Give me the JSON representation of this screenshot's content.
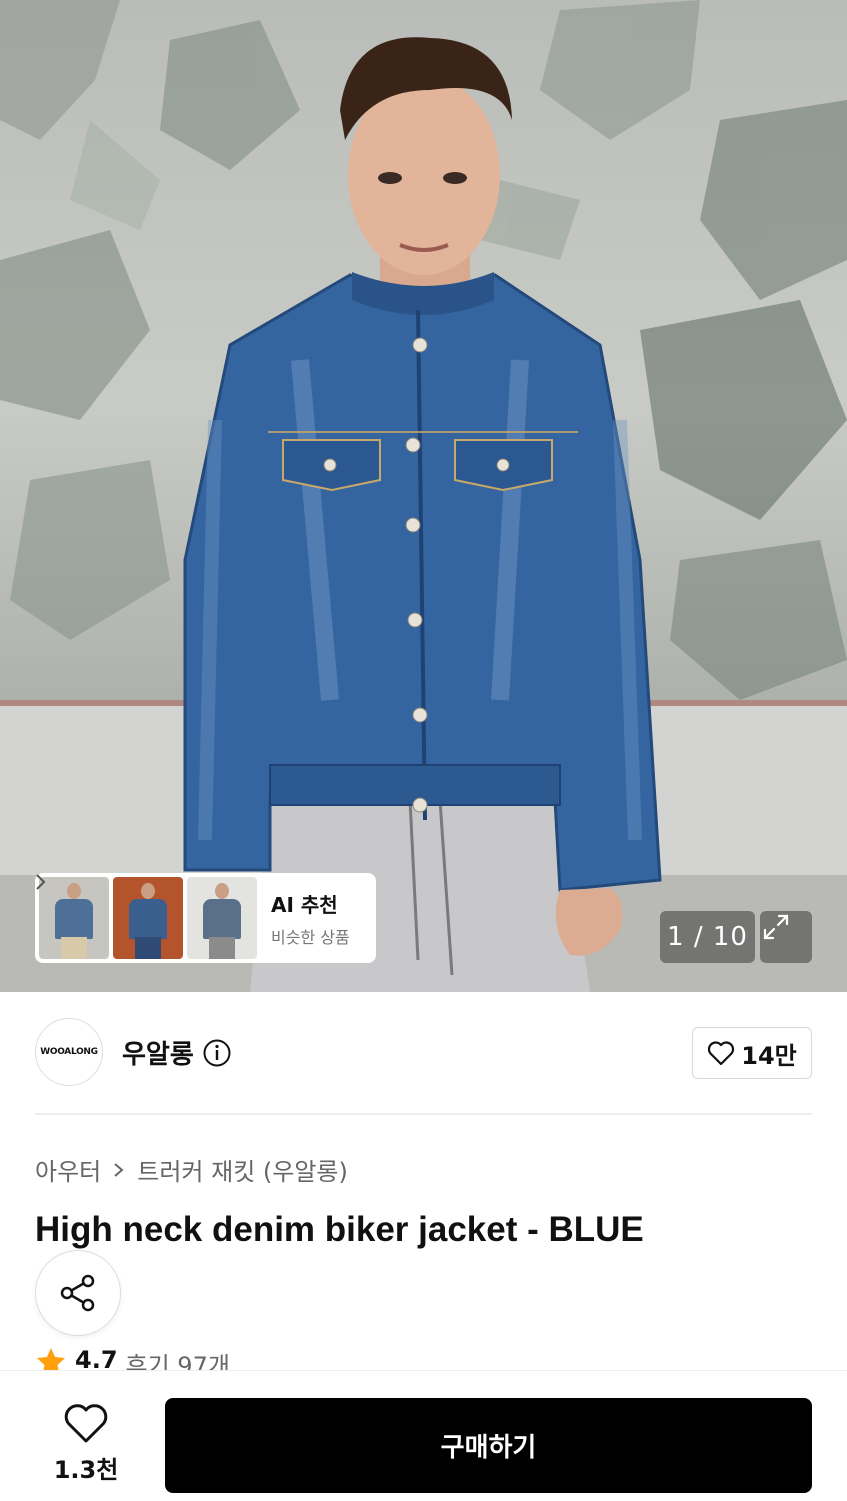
{
  "hero": {
    "image_alt": "Model wearing high neck denim biker jacket",
    "counter": "1 / 10"
  },
  "ai_recommend": {
    "title": "AI 추천",
    "subtitle": "비슷한 상품"
  },
  "brand": {
    "logo_text": "WOOALONG",
    "name": "우알롱",
    "likes": "14만"
  },
  "product": {
    "breadcrumb": [
      "아우터",
      "트러커 재킷 (우알롱)"
    ],
    "title": "High neck denim biker jacket - BLUE",
    "rating": "4.7",
    "reviews": "후기 97개"
  },
  "bottom_bar": {
    "like_count": "1.3천",
    "buy_label": "구매하기"
  },
  "colors": {
    "buy_button": "#000000",
    "star": "#ff9f0a",
    "denim": "#2f5f98"
  }
}
